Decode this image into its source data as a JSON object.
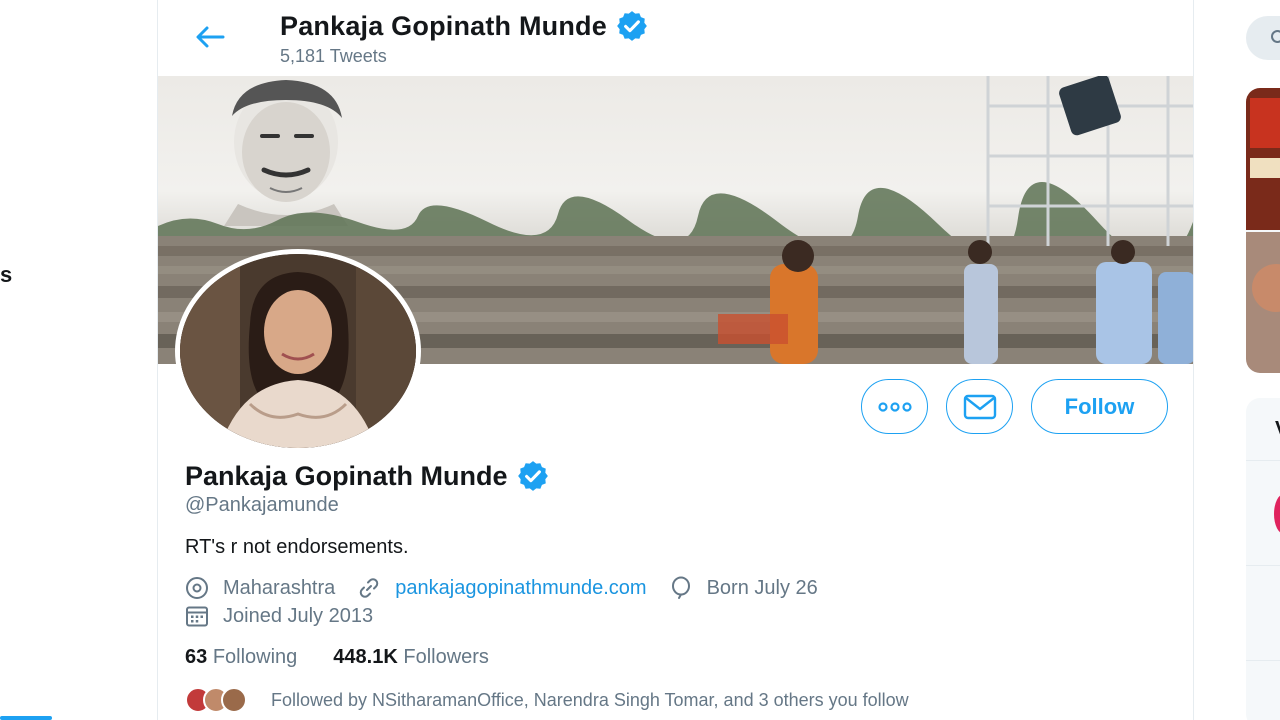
{
  "left_nav": {
    "fragment_text": "s"
  },
  "header": {
    "title": "Pankaja Gopinath Munde",
    "tweet_count": "5,181 Tweets"
  },
  "profile": {
    "name": "Pankaja Gopinath Munde",
    "handle": "@Pankajamunde",
    "bio": "RT's r not endorsements.",
    "location": "Maharashtra",
    "website": "pankajagopinathmunde.com",
    "birthday": "Born July 26",
    "joined": "Joined July 2013",
    "following_count": "63",
    "following_label": "Following",
    "followers_count": "448.1K",
    "followers_label": "Followers",
    "followed_by": "Followed by NSitharamanOffice, Narendra Singh Tomar, and 3 others you follow"
  },
  "actions": {
    "follow_label": "Follow"
  },
  "right_sidebar": {
    "card2_fragment": "V"
  },
  "colors": {
    "accent": "#1da1f2",
    "link": "#1b95e0",
    "muted": "#657786",
    "verified": "#1da1f2",
    "text": "#14171a"
  },
  "icons": {
    "back": "arrow-left-icon",
    "verified": "verified-badge-icon",
    "more": "more-dots-icon",
    "message": "envelope-icon",
    "location": "location-pin-icon",
    "link": "link-icon",
    "birthday": "balloon-icon",
    "calendar": "calendar-icon"
  }
}
